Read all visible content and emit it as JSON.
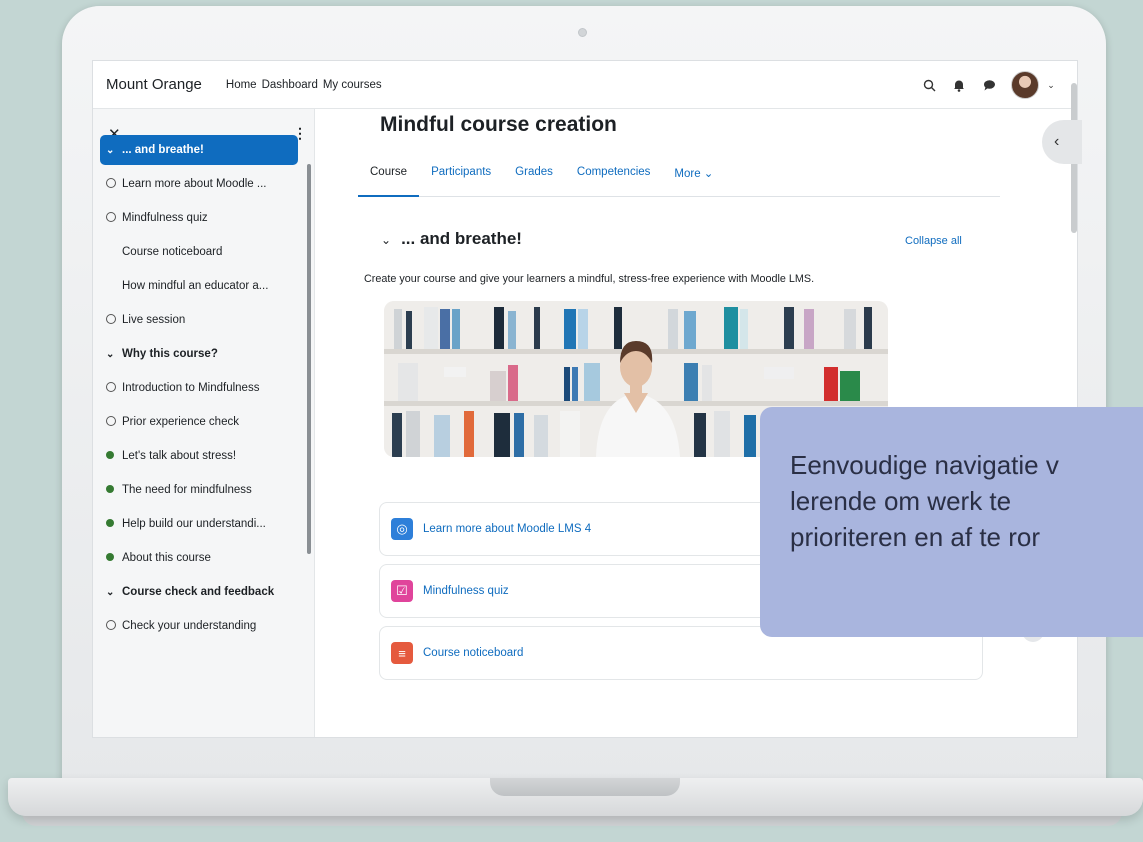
{
  "navbar": {
    "brand": "Mount Orange",
    "links": [
      "Home",
      "Dashboard",
      "My courses"
    ],
    "icons": [
      "search-icon",
      "bell-icon",
      "chat-icon",
      "user-avatar"
    ]
  },
  "drawer": {
    "items": [
      {
        "label": "... and breathe!",
        "marker": "chevron",
        "active": true
      },
      {
        "label": "Learn more about Moodle ...",
        "marker": "empty"
      },
      {
        "label": "Mindfulness quiz",
        "marker": "empty"
      },
      {
        "label": "Course noticeboard",
        "marker": "none"
      },
      {
        "label": "How mindful an educator a...",
        "marker": "none"
      },
      {
        "label": "Live session",
        "marker": "empty"
      },
      {
        "label": "Why this course?",
        "marker": "chevron",
        "section": true
      },
      {
        "label": "Introduction to Mindfulness",
        "marker": "empty"
      },
      {
        "label": "Prior experience check",
        "marker": "empty"
      },
      {
        "label": "Let's talk about stress!",
        "marker": "full"
      },
      {
        "label": "The need for mindfulness",
        "marker": "full"
      },
      {
        "label": "Help build our understandi...",
        "marker": "full"
      },
      {
        "label": "About this course",
        "marker": "full"
      },
      {
        "label": "Course check and feedback",
        "marker": "chevron",
        "section": true
      },
      {
        "label": "Check your understanding",
        "marker": "empty"
      }
    ]
  },
  "main": {
    "course_title": "Mindful course creation",
    "tabs": [
      "Course",
      "Participants",
      "Grades",
      "Competencies",
      "More ⌄"
    ],
    "section_title": "... and breathe!",
    "collapse_all": "Collapse all",
    "section_desc": "Create your course and give your learners a mindful, stress-free experience with Moodle LMS.",
    "activities": [
      {
        "label": "Learn more about Moodle LMS 4",
        "icon": "globe-icon",
        "color": "#2e7fd9"
      },
      {
        "label": "Mindfulness quiz",
        "icon": "quiz-icon",
        "color": "#e0449b"
      },
      {
        "label": "Course noticeboard",
        "icon": "forum-icon",
        "color": "#e55a3e"
      }
    ]
  },
  "callout": {
    "lines": [
      "Eenvoudige navigatie v",
      "lerende om werk te",
      "prioriteren en af te ror"
    ]
  }
}
